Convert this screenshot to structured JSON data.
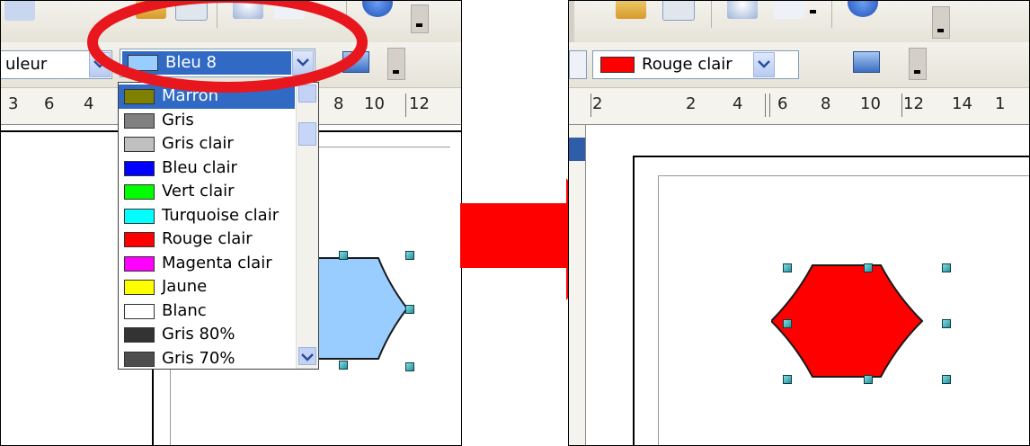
{
  "left": {
    "fill_style_label": "uleur",
    "fill_color_value": "Bleu 8",
    "ruler_ticks": [
      "6",
      "4",
      "8",
      "10",
      "12"
    ],
    "color_options": [
      {
        "name": "Marron",
        "color": "#808000"
      },
      {
        "name": "Gris",
        "color": "#808080"
      },
      {
        "name": "Gris clair",
        "color": "#c0c0c0"
      },
      {
        "name": "Bleu clair",
        "color": "#0000ff"
      },
      {
        "name": "Vert clair",
        "color": "#00ff00"
      },
      {
        "name": "Turquoise clair",
        "color": "#00ffff"
      },
      {
        "name": "Rouge clair",
        "color": "#ff0000"
      },
      {
        "name": "Magenta clair",
        "color": "#ff00ff"
      },
      {
        "name": "Jaune",
        "color": "#ffff00"
      },
      {
        "name": "Blanc",
        "color": "#ffffff"
      },
      {
        "name": "Gris 80%",
        "color": "#333333"
      },
      {
        "name": "Gris 70%",
        "color": "#4d4d4d"
      }
    ],
    "selected_swatch_color": "#99ccff",
    "shape_fill_color": "#99ccff",
    "highlight_color": "#e8161d"
  },
  "right": {
    "fill_color_value": "Rouge clair",
    "selected_swatch_color": "#ff0000",
    "ruler_ticks": [
      "2",
      "2",
      "4",
      "6",
      "8",
      "10",
      "12",
      "14",
      "1"
    ],
    "shape_fill_color": "#ff0000"
  },
  "arrow_color": "#ff0000"
}
